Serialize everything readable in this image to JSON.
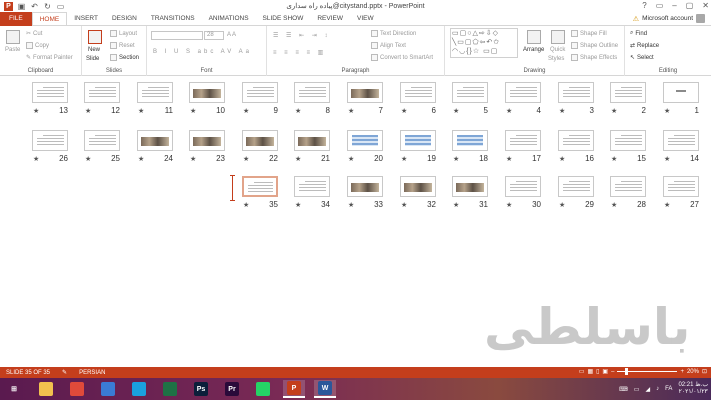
{
  "window": {
    "title": "پیاده راه سداری@citystand.pptx - PowerPoint",
    "controls": [
      "?",
      "▭",
      "–",
      "▢",
      "✕"
    ]
  },
  "quick_access": [
    "save-icon",
    "undo-icon",
    "redo-icon",
    "present-icon"
  ],
  "menu": {
    "tabs": [
      "FILE",
      "HOME",
      "INSERT",
      "DESIGN",
      "TRANSITIONS",
      "ANIMATIONS",
      "SLIDE SHOW",
      "REVIEW",
      "VIEW"
    ],
    "active": "HOME",
    "account": "Microsoft account"
  },
  "ribbon": {
    "clipboard": {
      "label": "Clipboard",
      "paste": "Paste",
      "cut": "Cut",
      "copy": "Copy",
      "format_painter": "Format Painter"
    },
    "slides": {
      "label": "Slides",
      "new_slide": "New",
      "new_slide2": "Slide",
      "layout": "Layout",
      "reset": "Reset",
      "section": "Section"
    },
    "font": {
      "label": "Font",
      "family": "",
      "size": "28"
    },
    "paragraph": {
      "label": "Paragraph",
      "text_direction": "Text Direction",
      "align_text": "Align Text",
      "convert_smartart": "Convert to SmartArt"
    },
    "drawing": {
      "label": "Drawing",
      "arrange": "Arrange",
      "quick_styles": "Quick",
      "quick_styles2": "Styles",
      "shape_fill": "Shape Fill",
      "shape_outline": "Shape Outline",
      "shape_effects": "Shape Effects"
    },
    "editing": {
      "label": "Editing",
      "find": "Find",
      "replace": "Replace",
      "select": "Select"
    }
  },
  "slides": [
    {
      "n": "1",
      "kind": "title"
    },
    {
      "n": "2",
      "kind": "text"
    },
    {
      "n": "3",
      "kind": "text"
    },
    {
      "n": "4",
      "kind": "text"
    },
    {
      "n": "5",
      "kind": "text"
    },
    {
      "n": "6",
      "kind": "text"
    },
    {
      "n": "7",
      "kind": "img"
    },
    {
      "n": "8",
      "kind": "text"
    },
    {
      "n": "9",
      "kind": "text"
    },
    {
      "n": "10",
      "kind": "img"
    },
    {
      "n": "11",
      "kind": "text"
    },
    {
      "n": "12",
      "kind": "text"
    },
    {
      "n": "13",
      "kind": "text"
    },
    {
      "n": "14",
      "kind": "text"
    },
    {
      "n": "15",
      "kind": "text"
    },
    {
      "n": "16",
      "kind": "text"
    },
    {
      "n": "17",
      "kind": "text"
    },
    {
      "n": "18",
      "kind": "tbl"
    },
    {
      "n": "19",
      "kind": "tbl"
    },
    {
      "n": "20",
      "kind": "tbl"
    },
    {
      "n": "21",
      "kind": "img"
    },
    {
      "n": "22",
      "kind": "img"
    },
    {
      "n": "23",
      "kind": "img"
    },
    {
      "n": "24",
      "kind": "img"
    },
    {
      "n": "25",
      "kind": "text"
    },
    {
      "n": "26",
      "kind": "text"
    },
    {
      "n": "27",
      "kind": "text"
    },
    {
      "n": "28",
      "kind": "text"
    },
    {
      "n": "29",
      "kind": "text"
    },
    {
      "n": "30",
      "kind": "text"
    },
    {
      "n": "31",
      "kind": "img"
    },
    {
      "n": "32",
      "kind": "img"
    },
    {
      "n": "33",
      "kind": "img"
    },
    {
      "n": "34",
      "kind": "text"
    },
    {
      "n": "35",
      "kind": "text"
    }
  ],
  "slide_star": "★",
  "watermark": "باسلطی",
  "status": {
    "slide_info": "SLIDE 35 OF 35",
    "language": "PERSIAN",
    "zoom": "20%"
  },
  "taskbar": {
    "apps": [
      {
        "name": "start-button",
        "glyph": "⊞"
      },
      {
        "name": "file-explorer-icon",
        "glyph": ""
      },
      {
        "name": "chrome-icon",
        "glyph": ""
      },
      {
        "name": "app-icon",
        "glyph": ""
      },
      {
        "name": "app-icon-2",
        "glyph": ""
      },
      {
        "name": "excel-icon",
        "glyph": ""
      },
      {
        "name": "photoshop-icon",
        "glyph": "Ps"
      },
      {
        "name": "premiere-icon",
        "glyph": "Pr"
      },
      {
        "name": "whatsapp-icon",
        "glyph": ""
      },
      {
        "name": "powerpoint-icon",
        "glyph": "P"
      },
      {
        "name": "word-icon",
        "glyph": "W"
      }
    ],
    "lang": "FA",
    "time": "02:21 ب.ظ",
    "date": "۲۰۲۱/۰۱/۲۳"
  },
  "colors": {
    "accent": "#c43e1c",
    "taskbar": "#6a2553"
  }
}
